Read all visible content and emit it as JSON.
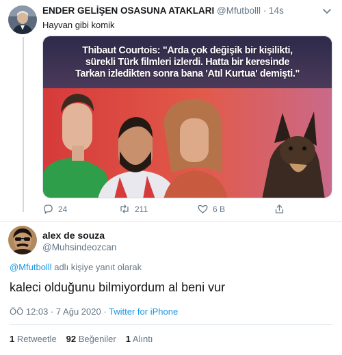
{
  "tweet1": {
    "display_name": "ENDER GELİŞEN OSASUNA ATAKLARI",
    "handle": "@Mfutbolll",
    "separator": "·",
    "time": "14s",
    "text": "Hayvan gibi komik",
    "avatar_icon": "profile-photo-icon",
    "media": {
      "caption_lines": [
        "Thibaut Courtois: \"Arda çok değişik bir kişilikti,",
        "sürekli Türk filmleri izlerdi. Hatta bir keresinde",
        "Tarkan izledikten sonra bana 'Atıl Kurtua' demişti.\""
      ]
    },
    "actions": {
      "reply_count": "24",
      "retweet_count": "211",
      "like_count": "6 B"
    }
  },
  "tweet2": {
    "display_name": "alex de souza",
    "handle": "@Muhsindeozcan",
    "avatar_icon": "profile-photo-icon",
    "reply_mention": "@Mfutbolll",
    "reply_suffix": " adlı kişiye yanıt olarak",
    "text": "kaleci olduğunu bilmiyordum al beni vur",
    "timestamp": "ÖÖ 12:03 · 7 Ağu 2020 · ",
    "source": "Twitter for iPhone",
    "stats": {
      "retweets_count": "1",
      "retweets_label": "Retweetle",
      "likes_count": "92",
      "likes_label": "Beğeniler",
      "quotes_count": "1",
      "quotes_label": "Alıntı"
    }
  },
  "colors": {
    "link": "#1b95e0",
    "secondary_text": "#657786",
    "primary_text": "#14171a",
    "divider": "#e6ecf0"
  }
}
